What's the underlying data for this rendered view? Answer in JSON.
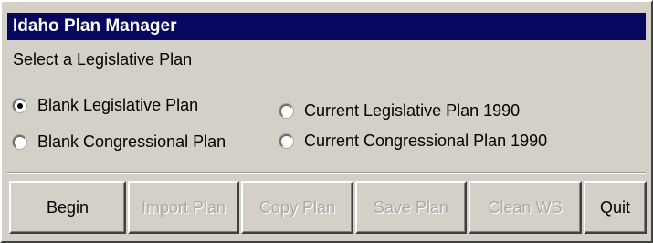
{
  "window": {
    "title": "Idaho Plan Manager",
    "subtitle": "Select a Legislative Plan"
  },
  "plans": [
    {
      "label": "Blank Legislative Plan",
      "selected": true
    },
    {
      "label": "Current Legislative Plan 1990",
      "selected": false
    },
    {
      "label": "Blank Congressional Plan",
      "selected": false
    },
    {
      "label": "Current Congressional Plan 1990",
      "selected": false
    }
  ],
  "buttons": [
    {
      "label": "Begin",
      "enabled": true
    },
    {
      "label": "Import Plan",
      "enabled": false
    },
    {
      "label": "Copy Plan",
      "enabled": false
    },
    {
      "label": "Save Plan",
      "enabled": false
    },
    {
      "label": "Clean WS",
      "enabled": false
    },
    {
      "label": "Quit",
      "enabled": true
    }
  ],
  "colors": {
    "titlebar_bg": "#07075f",
    "titlebar_text": "#ffffff",
    "window_bg": "#d4d0c8",
    "disabled_text": "#a9a9a9"
  }
}
